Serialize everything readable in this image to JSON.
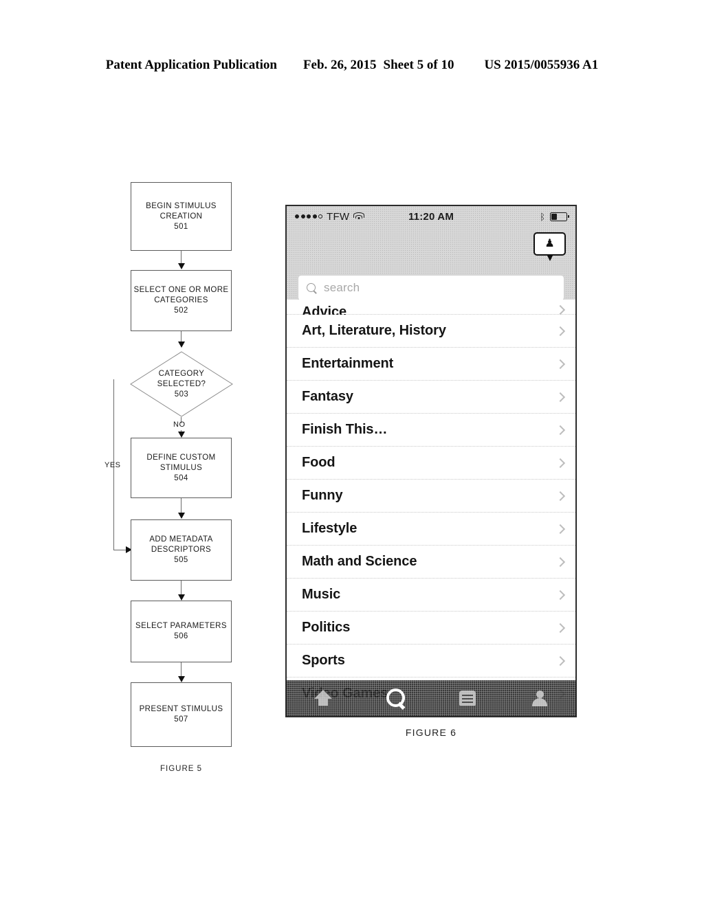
{
  "header": {
    "publication": "Patent Application Publication",
    "date": "Feb. 26, 2015",
    "sheet": "Sheet 5 of 10",
    "number": "US 2015/0055936 A1"
  },
  "figure5": {
    "caption": "FIGURE 5",
    "nodes": [
      {
        "id": "501",
        "line1": "BEGIN STIMULUS",
        "line2": "CREATION",
        "ref": "501"
      },
      {
        "id": "502",
        "line1": "SELECT ONE OR MORE",
        "line2": "CATEGORIES",
        "ref": "502"
      },
      {
        "id": "503",
        "line1": "CATEGORY",
        "line2": "SELECTED?",
        "ref": "503"
      },
      {
        "id": "504",
        "line1": "DEFINE CUSTOM",
        "line2": "STIMULUS",
        "ref": "504"
      },
      {
        "id": "505",
        "line1": "ADD METADATA",
        "line2": "DESCRIPTORS",
        "ref": "505"
      },
      {
        "id": "506",
        "line1": "SELECT PARAMETERS",
        "line2": "",
        "ref": "506"
      },
      {
        "id": "507",
        "line1": "PRESENT STIMULUS",
        "line2": "",
        "ref": "507"
      }
    ],
    "edge_labels": {
      "no": "NO",
      "yes": "YES"
    }
  },
  "figure6": {
    "caption": "FIGURE 6",
    "status_bar": {
      "carrier": "TFW",
      "time": "11:20 AM",
      "signal_filled_dots": 4,
      "signal_empty_dots": 1,
      "wifi_icon": "wifi-icon",
      "bluetooth_icon": "bluetooth-icon",
      "bluetooth_glyph": "ᛒ",
      "battery_icon": "battery-icon"
    },
    "header": {
      "badge_icon": "person-callout-icon",
      "badge_glyph": "♟"
    },
    "search": {
      "icon": "search-icon",
      "placeholder": "search",
      "value": ""
    },
    "list": {
      "disclosure_icon": "chevron-right-icon",
      "items": [
        {
          "label": "Advice",
          "clipped": true
        },
        {
          "label": "Art, Literature, History",
          "clipped": false
        },
        {
          "label": "Entertainment",
          "clipped": false
        },
        {
          "label": "Fantasy",
          "clipped": false
        },
        {
          "label": "Finish This…",
          "clipped": false
        },
        {
          "label": "Food",
          "clipped": false
        },
        {
          "label": "Funny",
          "clipped": false
        },
        {
          "label": "Lifestyle",
          "clipped": false
        },
        {
          "label": "Math and Science",
          "clipped": false
        },
        {
          "label": "Music",
          "clipped": false
        },
        {
          "label": "Politics",
          "clipped": false
        },
        {
          "label": "Sports",
          "clipped": false
        },
        {
          "label": "Video Games",
          "clipped": false
        }
      ]
    },
    "tab_bar": {
      "items": [
        {
          "icon": "home-icon",
          "active": false
        },
        {
          "icon": "search-icon",
          "active": true
        },
        {
          "icon": "list-icon",
          "active": false
        },
        {
          "icon": "person-icon",
          "active": false
        }
      ]
    }
  },
  "colors": {
    "ink": "#000000",
    "line": "#6a6a6a",
    "tab_bar": "#282828",
    "placeholder": "#a8a8a8",
    "chevron": "#bdbdbd"
  }
}
